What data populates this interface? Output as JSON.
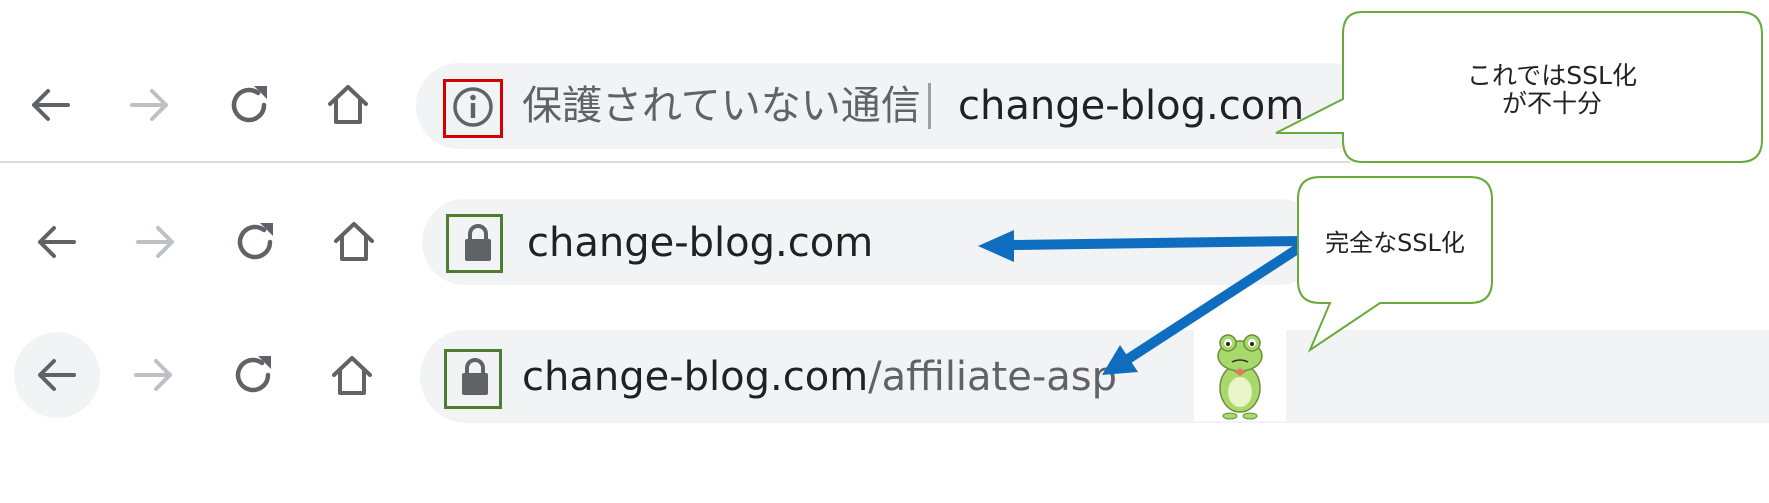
{
  "colors": {
    "omnibox_bg": "#f1f3f4",
    "icon_active": "#5f6368",
    "icon_disabled": "#bdc1c6",
    "warning_highlight": "#d40000",
    "secure_highlight": "#4e7d32",
    "arrow_blue": "#0f6dbf",
    "callout_border": "#6aaa3c"
  },
  "row1": {
    "nav_icons": [
      "back-arrow-icon",
      "forward-arrow-icon",
      "reload-icon",
      "home-icon"
    ],
    "security_icon": "info-circle-icon",
    "security_state_label": "保護されていない通信",
    "url": "change-blog.com"
  },
  "row2": {
    "nav_icons": [
      "back-arrow-icon",
      "forward-arrow-icon",
      "reload-icon",
      "home-icon"
    ],
    "security_icon": "lock-icon",
    "url": "change-blog.com"
  },
  "row3": {
    "nav_icons": [
      "back-arrow-icon",
      "forward-arrow-icon",
      "reload-icon",
      "home-icon"
    ],
    "security_icon": "lock-icon",
    "url_domain": "change-blog.com",
    "url_path": "/affiliate-asp"
  },
  "callouts": {
    "top_line1": "これではSSL化",
    "top_line2": "が不十分",
    "middle": "完全なSSL化"
  },
  "illustration": "frog-character"
}
